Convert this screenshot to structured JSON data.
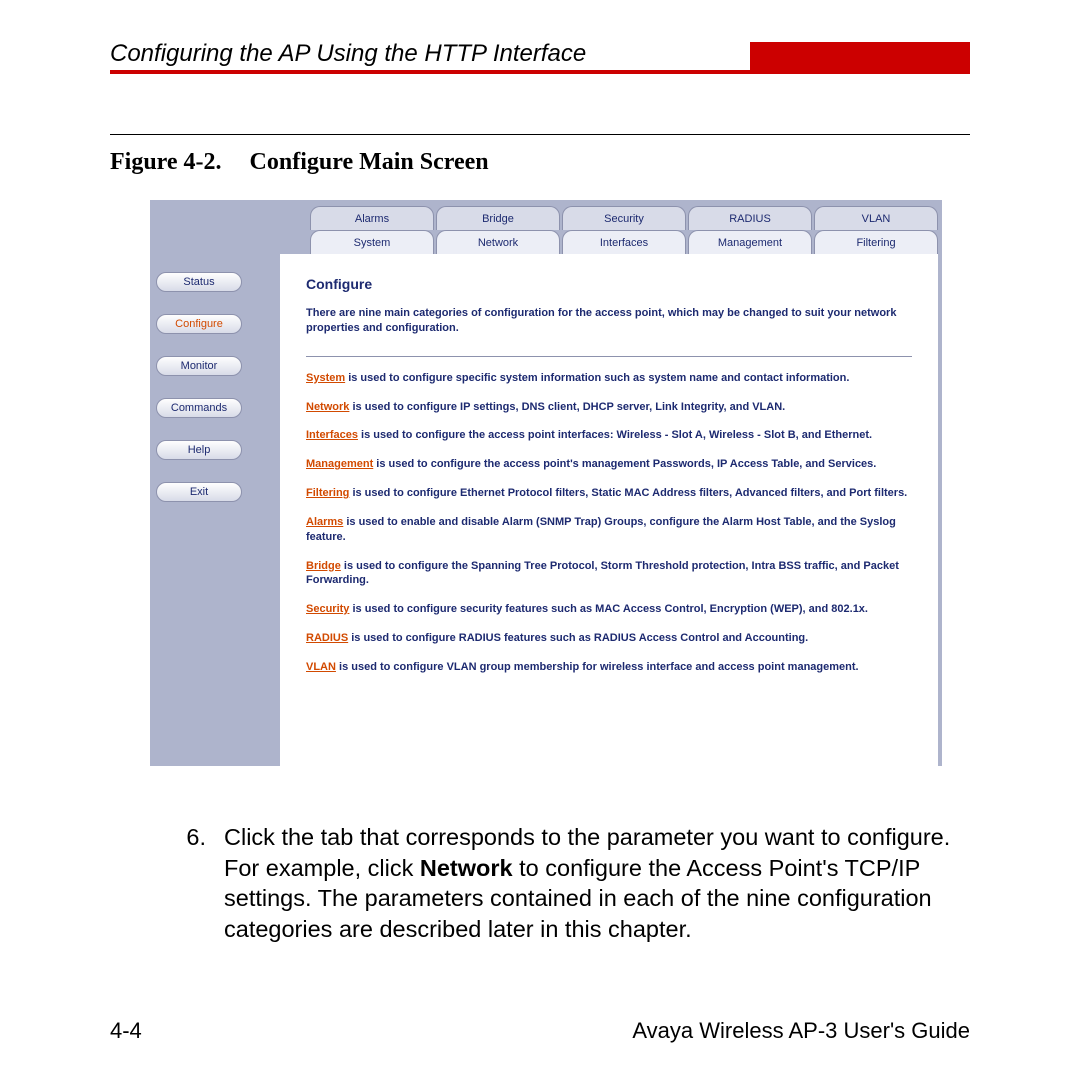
{
  "header": {
    "title": "Configuring the AP Using the HTTP Interface"
  },
  "figure": {
    "label": "Figure 4-2.",
    "title": "Configure Main Screen"
  },
  "screenshot": {
    "tabs_row1": [
      "Alarms",
      "Bridge",
      "Security",
      "RADIUS",
      "VLAN"
    ],
    "tabs_row2": [
      "System",
      "Network",
      "Interfaces",
      "Management",
      "Filtering"
    ],
    "nav": [
      "Status",
      "Configure",
      "Monitor",
      "Commands",
      "Help",
      "Exit"
    ],
    "nav_active_index": 1,
    "panel_title": "Configure",
    "panel_intro": "There are nine main categories of configuration for the access point, which may be changed to suit your network properties and configuration.",
    "categories": [
      {
        "link": "System",
        "text": " is used to configure specific system information such as system name and contact information."
      },
      {
        "link": "Network",
        "text": " is used to configure IP settings, DNS client, DHCP server, Link Integrity, and VLAN."
      },
      {
        "link": "Interfaces",
        "text": " is used to configure the access point interfaces: Wireless - Slot A, Wireless - Slot B, and Ethernet."
      },
      {
        "link": "Management",
        "text": " is used to configure the access point's management Passwords, IP Access Table, and Services."
      },
      {
        "link": "Filtering",
        "text": " is used to configure Ethernet Protocol filters, Static MAC Address filters, Advanced filters, and Port filters."
      },
      {
        "link": "Alarms",
        "text": " is used to enable and disable Alarm (SNMP Trap) Groups, configure the Alarm Host Table, and the Syslog feature."
      },
      {
        "link": "Bridge",
        "text": " is used to configure the Spanning Tree Protocol, Storm Threshold protection, Intra BSS traffic, and Packet Forwarding."
      },
      {
        "link": "Security",
        "text": " is used to configure security features such as MAC Access Control, Encryption (WEP), and 802.1x."
      },
      {
        "link": "RADIUS",
        "text": " is used to configure RADIUS features such as RADIUS Access Control and Accounting."
      },
      {
        "link": "VLAN",
        "text": " is used to configure VLAN group membership for wireless interface and access point management."
      }
    ]
  },
  "instruction": {
    "number": "6.",
    "pre": "Click the tab that corresponds to the parameter you want to configure. For example, click ",
    "bold": "Network",
    "post": " to configure the Access Point's TCP/IP settings. The parameters contained in each of the nine configuration categories are described later in this chapter."
  },
  "footer": {
    "page": "4-4",
    "doc": "Avaya Wireless AP-3 User's Guide"
  }
}
